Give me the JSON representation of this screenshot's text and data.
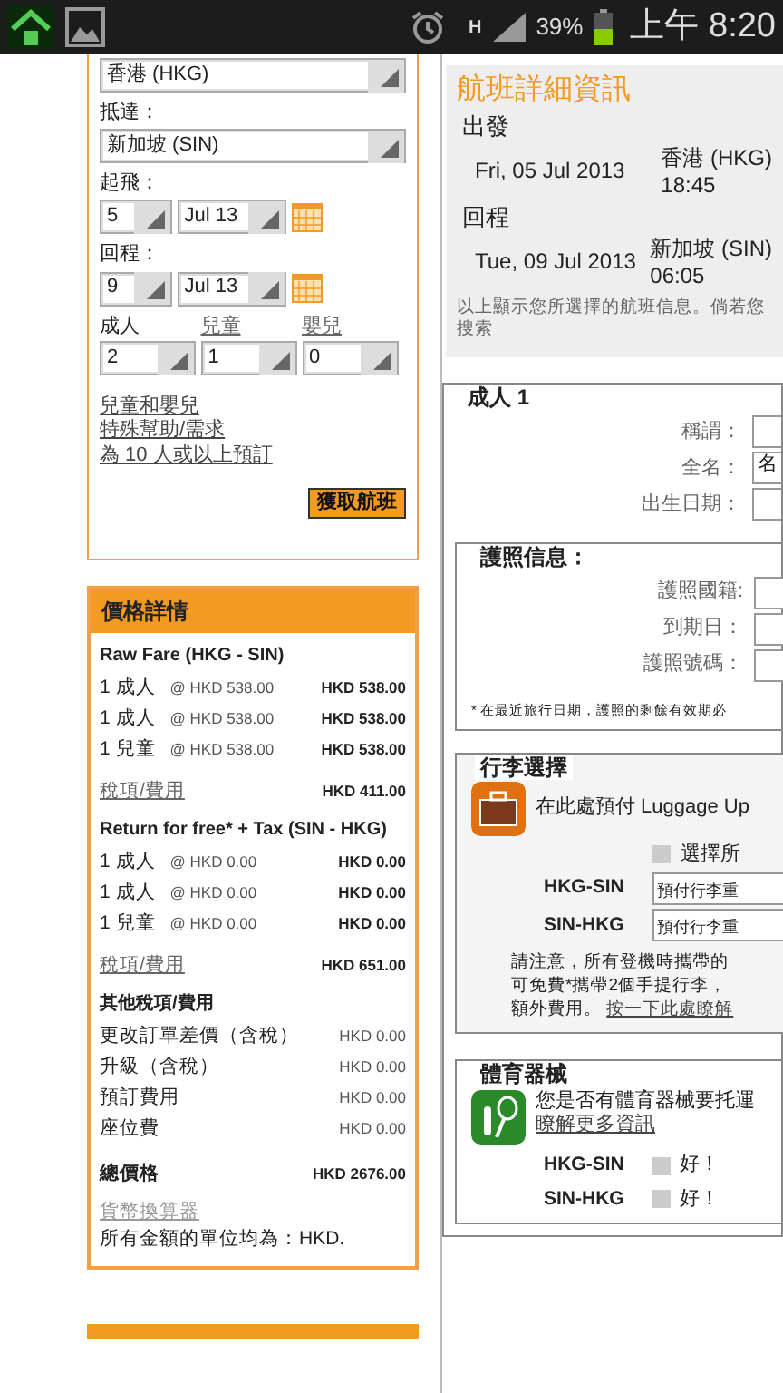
{
  "status_bar": {
    "network": "H",
    "battery_text": "39%",
    "time": "上午 8:20"
  },
  "search_form": {
    "origin": "香港 (HKG)",
    "destination_label": "抵達：",
    "destination": "新加坡 (SIN)",
    "depart_label": "起飛：",
    "depart_day": "5",
    "depart_month": "Jul 13",
    "return_label": "回程：",
    "return_day": "9",
    "return_month": "Jul 13",
    "passengers": [
      {
        "label": "成人",
        "value": "2",
        "link": false
      },
      {
        "label": "兒童",
        "value": "1",
        "link": true
      },
      {
        "label": "嬰兒",
        "value": "0",
        "link": true
      }
    ],
    "links": [
      "兒童和嬰兒",
      "特殊幫助/需求",
      "為 10 人或以上預訂"
    ],
    "button": "獲取航班"
  },
  "price_details": {
    "title": "價格詳情",
    "rows": [
      {
        "kind": "heading",
        "label": "Raw Fare (HKG - SIN)"
      },
      {
        "kind": "item",
        "label": "1 成人",
        "unit": "@ HKD  538.00",
        "amount": "HKD  538.00"
      },
      {
        "kind": "item",
        "label": "1 成人",
        "unit": "@ HKD  538.00",
        "amount": "HKD  538.00"
      },
      {
        "kind": "item",
        "label": "1 兒童",
        "unit": "@ HKD  538.00",
        "amount": "HKD  538.00"
      },
      {
        "kind": "link",
        "label": "稅項/費用",
        "amount": "HKD  411.00"
      },
      {
        "kind": "heading",
        "label": "Return for free* + Tax (SIN - HKG)"
      },
      {
        "kind": "item",
        "label": "1 成人",
        "unit": "@ HKD  0.00",
        "amount": "HKD  0.00"
      },
      {
        "kind": "item",
        "label": "1 成人",
        "unit": "@ HKD  0.00",
        "amount": "HKD  0.00"
      },
      {
        "kind": "item",
        "label": "1 兒童",
        "unit": "@ HKD  0.00",
        "amount": "HKD  0.00"
      },
      {
        "kind": "link",
        "label": "稅項/費用",
        "amount": "HKD  651.00"
      },
      {
        "kind": "heading",
        "label": "其他稅項/費用"
      },
      {
        "kind": "fee",
        "label": "更改訂單差價（含稅）",
        "amount": "HKD  0.00"
      },
      {
        "kind": "fee",
        "label": "升級（含稅）",
        "amount": "HKD  0.00"
      },
      {
        "kind": "fee",
        "label": "預訂費用",
        "amount": "HKD  0.00"
      },
      {
        "kind": "fee",
        "label": "座位費",
        "amount": "HKD  0.00"
      },
      {
        "kind": "total",
        "label": "總價格",
        "amount": "HKD  2676.00"
      }
    ],
    "converter_link": "貨幣換算器",
    "note": "所有金額的單位均為：HKD."
  },
  "flight_details": {
    "title": "航班詳細資訊",
    "segments": [
      {
        "label": "出發",
        "date": "Fri, 05 Jul 2013",
        "place": "香港 (HKG)",
        "time": "18:45"
      },
      {
        "label": "回程",
        "date": "Tue, 09 Jul 2013",
        "place": "新加坡 (SIN)",
        "time": "06:05"
      }
    ],
    "note_lines": [
      "以上顯示您所選擇的航班信息。倘若您",
      "搜索"
    ]
  },
  "passenger": {
    "legend": "成人 1",
    "fields": [
      {
        "label": "稱謂："
      },
      {
        "label": "全名：",
        "value": "名"
      },
      {
        "label": "出生日期："
      }
    ],
    "passport": {
      "legend": "護照信息：",
      "fields": [
        {
          "label": "護照國籍:"
        },
        {
          "label": "到期日："
        },
        {
          "label": "護照號碼："
        }
      ],
      "note": "* 在最近旅行日期，護照的剩餘有效期必"
    }
  },
  "luggage": {
    "legend": "行李選擇",
    "text": "在此處預付 Luggage Up",
    "checkbox": {
      "label": "選擇所",
      "checked": false
    },
    "routes": [
      {
        "route": "HKG-SIN",
        "value": "預付行李重"
      },
      {
        "route": "SIN-HKG",
        "value": "預付行李重"
      }
    ],
    "note_lines": [
      "請注意，所有登機時攜帶的",
      "可免費*攜帶2個手提行李，",
      "額外費用。"
    ],
    "note_link": "按一下此處瞭解"
  },
  "sports": {
    "legend": "體育器械",
    "text": "您是否有體育器械要托運",
    "link": "瞭解更多資訊",
    "routes": [
      {
        "route": "HKG-SIN",
        "option": "好！",
        "checked": false
      },
      {
        "route": "SIN-HKG",
        "option": "好！",
        "checked": false
      }
    ]
  }
}
